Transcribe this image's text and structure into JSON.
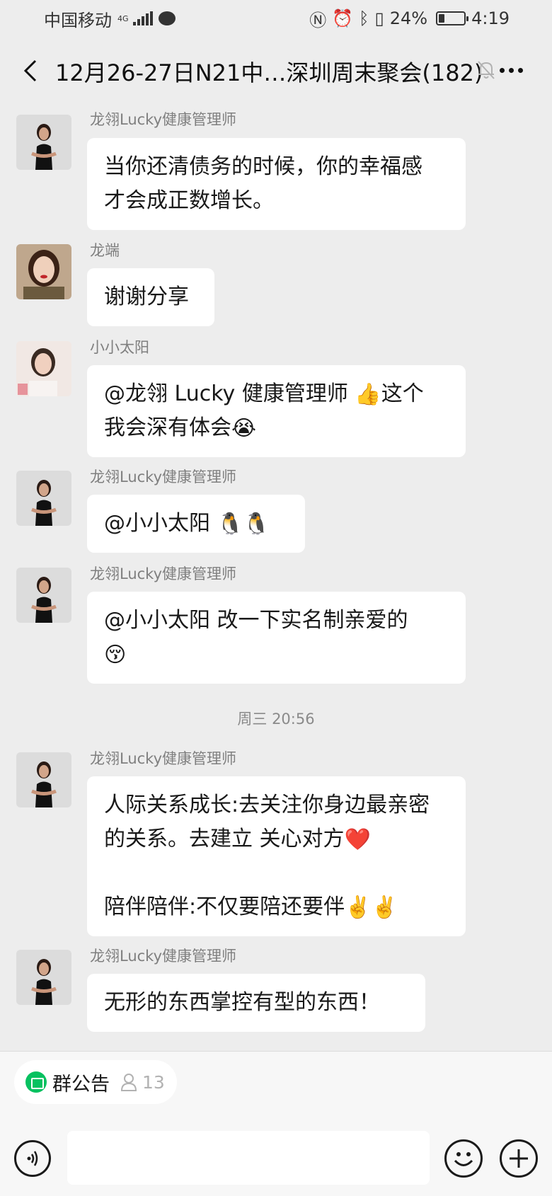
{
  "status_bar": {
    "carrier": "中国移动",
    "network": "4G",
    "battery": "24%",
    "time": "4:19",
    "battery_level": 0.24,
    "icons": [
      "nfc-icon",
      "alarm-icon",
      "bluetooth-icon",
      "vibrate-icon"
    ]
  },
  "header": {
    "title": "12月26-27日N21中…深圳周末聚会(182)",
    "back_icon": "chevron-left-icon",
    "mute_icon": "bell-off-icon",
    "more_icon": "more-dots-icon"
  },
  "messages": [
    {
      "sender": "龙翎Lucky健康管理师",
      "avatar": "woman-black-dress",
      "lines": [
        [
          {
            "t": "当你还清债务的时候，你的幸福感"
          }
        ],
        [
          {
            "t": "才会成正数增长。"
          }
        ]
      ]
    },
    {
      "sender": "龙端",
      "avatar": "woman-red-lips",
      "lines": [
        [
          {
            "t": "谢谢分享"
          }
        ]
      ]
    },
    {
      "sender": "小小太阳",
      "avatar": "woman-light-bg",
      "lines": [
        [
          {
            "t": "@龙翎 Lucky 健康管理师 "
          },
          {
            "e": "👍"
          },
          {
            "t": "这个"
          }
        ],
        [
          {
            "t": "我会深有体会"
          },
          {
            "e": "😭"
          }
        ]
      ]
    },
    {
      "sender": "龙翎Lucky健康管理师",
      "avatar": "woman-black-dress",
      "lines": [
        [
          {
            "t": "@小小太阳 "
          },
          {
            "e": "🐧"
          },
          {
            "e": "🐧"
          }
        ]
      ]
    },
    {
      "sender": "龙翎Lucky健康管理师",
      "avatar": "woman-black-dress",
      "lines": [
        [
          {
            "t": "@小小太阳  改一下实名制亲爱的"
          }
        ],
        [
          {
            "e": "😚"
          }
        ]
      ]
    },
    {
      "timestamp": "周三 20:56"
    },
    {
      "sender": "龙翎Lucky健康管理师",
      "avatar": "woman-black-dress",
      "lines": [
        [
          {
            "t": "人际关系成长:去关注你身边最亲密"
          }
        ],
        [
          {
            "t": "的关系。去建立 关心对方"
          },
          {
            "e": "❤️"
          }
        ],
        [],
        [
          {
            "t": "陪伴陪伴:不仅要陪还要伴"
          },
          {
            "e": "✌️"
          },
          {
            "e": "✌️"
          }
        ]
      ]
    },
    {
      "sender": "龙翎Lucky健康管理师",
      "avatar": "woman-black-dress",
      "lines": [
        [
          {
            "t": "无形的东西掌控有型的东西！"
          }
        ]
      ]
    }
  ],
  "bottom": {
    "notice_label": "群公告",
    "member_count": "13",
    "voice_icon": "voice-icon",
    "emoji_icon": "emoji-icon",
    "plus_icon": "plus-icon"
  },
  "colors": {
    "background": "#ededed",
    "bubble": "#ffffff",
    "accent_green": "#07c160"
  }
}
